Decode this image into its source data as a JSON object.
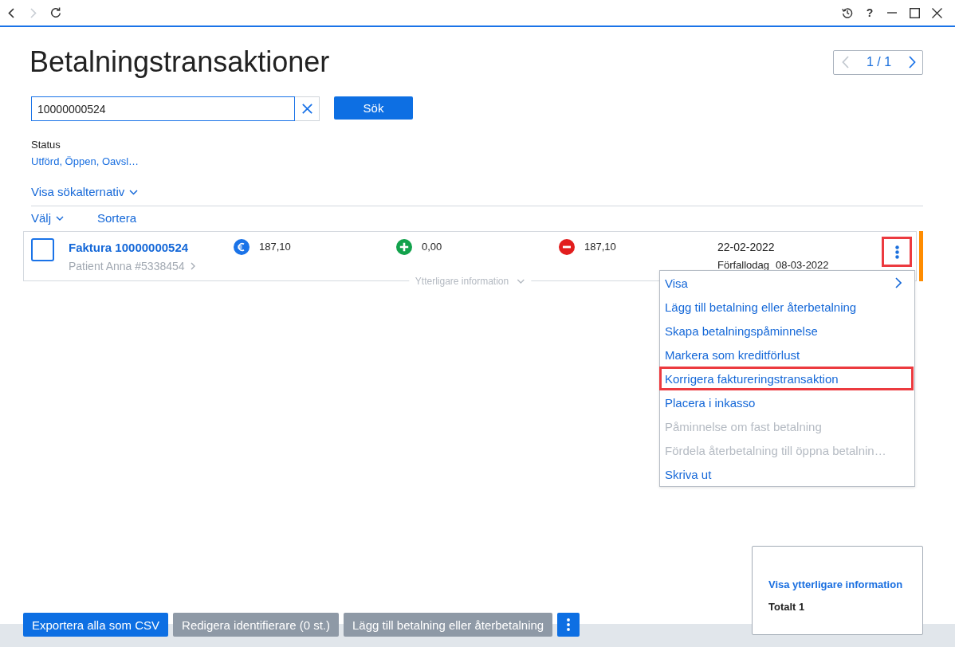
{
  "titlebar": {
    "nav_buttons": [
      {
        "disabled": false
      },
      {
        "disabled": true
      },
      {
        "disabled": false
      }
    ],
    "help": "?"
  },
  "header": {
    "title": "Betalningstransaktioner",
    "pager": {
      "text": "1 / 1",
      "prev_disabled": true,
      "next_disabled": false
    }
  },
  "search": {
    "value": "10000000524",
    "button": "Sök"
  },
  "filter": {
    "label": "Status",
    "value": "Utförd, Öppen, Oavsl…"
  },
  "search_options": {
    "label": "Visa sökalternativ",
    "expanded": false
  },
  "list_toolbar": {
    "select": "Välj",
    "sort": "Sortera"
  },
  "transactions": [
    {
      "checked": false,
      "title": "Faktura 10000000524",
      "patient": "Patient Anna #5338454",
      "amounts": [
        {
          "kind": "amount",
          "value": "187,10"
        },
        {
          "kind": "paid",
          "value": "0,00"
        },
        {
          "kind": "remaining",
          "value": "187,10"
        }
      ],
      "date": "22-02-2022",
      "due_label": "Förfallodag",
      "due_date": "08-03-2022",
      "color": "#ff8c00",
      "details_label": "Ytterligare information",
      "details_expanded": false,
      "more_highlighted": true,
      "menu": {
        "open": true,
        "items": [
          {
            "label": "Visa",
            "submenu": true,
            "disabled": false,
            "highlighted": false
          },
          {
            "label": "Lägg till betalning eller återbetalning",
            "submenu": false,
            "disabled": false,
            "highlighted": false
          },
          {
            "label": "Skapa betalningspåminnelse",
            "submenu": false,
            "disabled": false,
            "highlighted": false
          },
          {
            "label": "Markera som kreditförlust",
            "submenu": false,
            "disabled": false,
            "highlighted": false
          },
          {
            "label": "Korrigera faktureringstransaktion",
            "submenu": false,
            "disabled": false,
            "highlighted": true
          },
          {
            "label": "Placera i inkasso",
            "submenu": false,
            "disabled": false,
            "highlighted": false
          },
          {
            "label": "Påminnelse om fast betalning",
            "submenu": false,
            "disabled": true,
            "highlighted": false
          },
          {
            "label": "Fördela återbetalning till öppna betalnin…",
            "submenu": false,
            "disabled": true,
            "highlighted": false
          },
          {
            "label": "Skriva ut",
            "submenu": false,
            "disabled": false,
            "highlighted": false
          }
        ]
      }
    }
  ],
  "footer": {
    "buttons": [
      {
        "label": "Exportera alla som CSV",
        "disabled": false
      },
      {
        "label": "Redigera identifierare (0 st.)",
        "disabled": true
      },
      {
        "label": "Lägg till betalning eller återbetalning",
        "disabled": true
      }
    ]
  },
  "summary": {
    "link": "Visa ytterligare information",
    "total": "Totalt 1"
  }
}
